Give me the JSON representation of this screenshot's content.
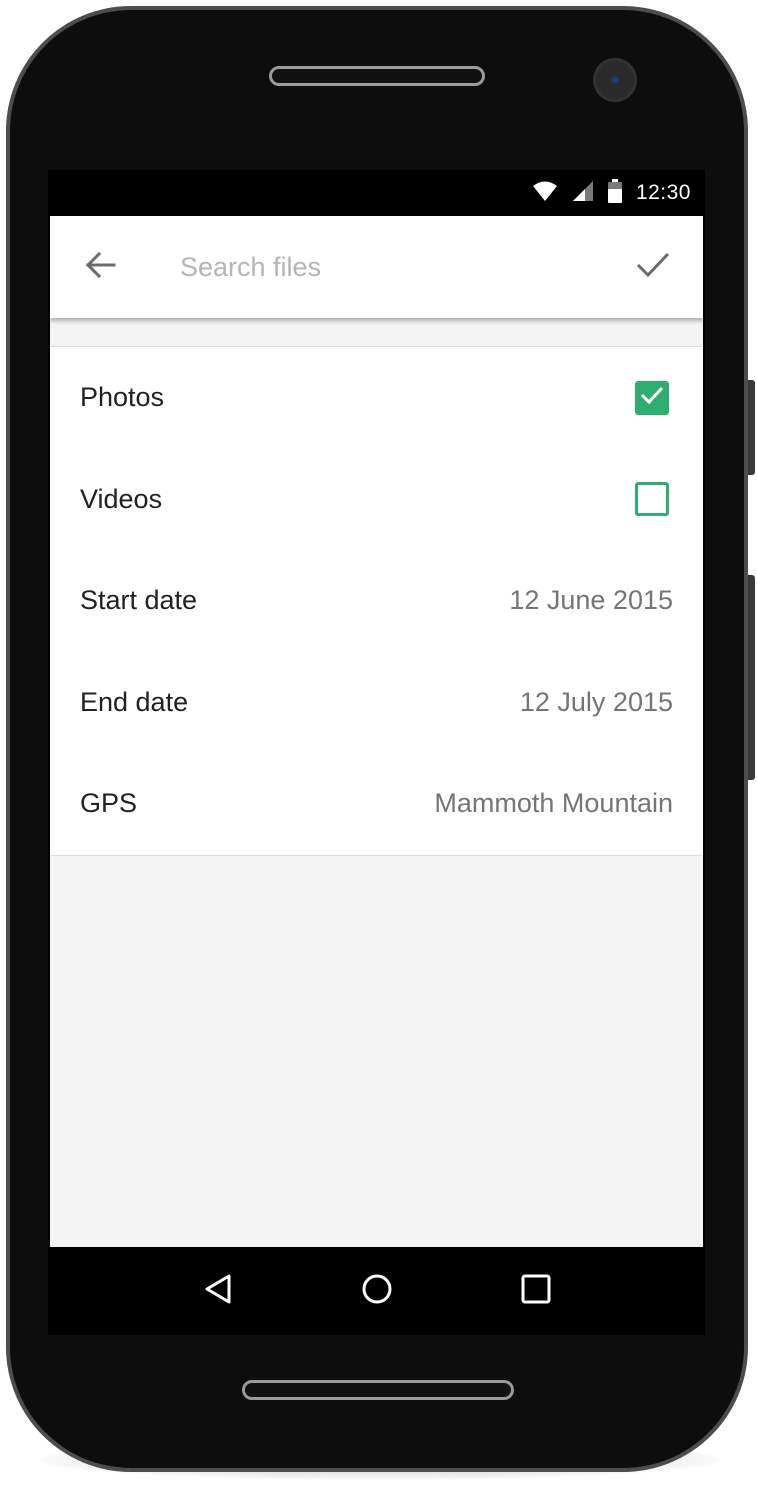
{
  "status_bar": {
    "time": "12:30",
    "icons": [
      "wifi-icon",
      "cellular-signal-icon",
      "battery-icon"
    ]
  },
  "toolbar": {
    "back_icon": "arrow-left-icon",
    "search_placeholder": "Search files",
    "search_value": "",
    "confirm_icon": "checkmark-icon"
  },
  "filters": {
    "photos": {
      "label": "Photos",
      "checked": true
    },
    "videos": {
      "label": "Videos",
      "checked": false
    },
    "start_date": {
      "label": "Start date",
      "value": "12 June 2015"
    },
    "end_date": {
      "label": "End date",
      "value": "12 July 2015"
    },
    "gps": {
      "label": "GPS",
      "value": "Mammoth Mountain"
    }
  },
  "nav_bar": {
    "icons": [
      "back-triangle-icon",
      "home-circle-icon",
      "recents-square-icon"
    ]
  },
  "colors": {
    "accent": "#2fae6f",
    "toolbar_bg": "#ffffff",
    "content_bg": "#f4f4f4",
    "label_text": "#212121",
    "value_text": "#757575",
    "placeholder_text": "#b5b5b5"
  }
}
